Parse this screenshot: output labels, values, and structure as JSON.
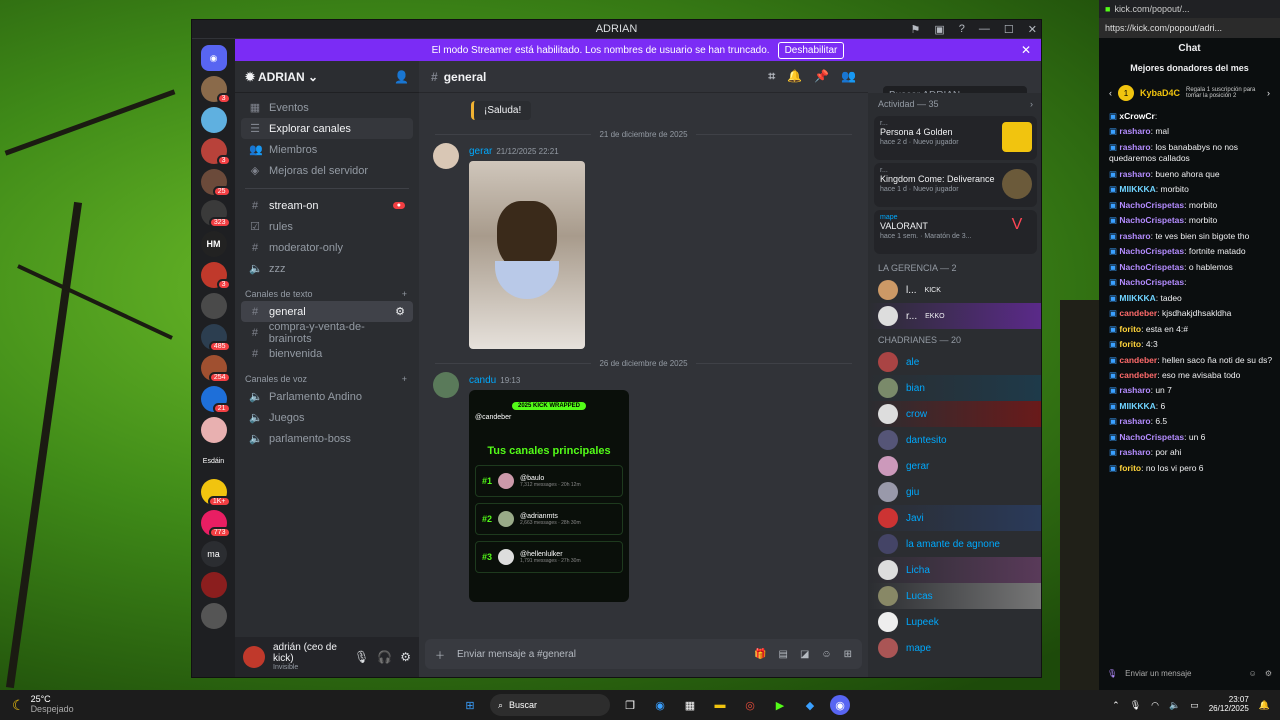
{
  "window": {
    "title": "ADRIAN"
  },
  "banner": {
    "text": "El modo Streamer está habilitado. Los nombres de usuario se han truncado.",
    "button": "Deshabilitar"
  },
  "server": {
    "name": "ADRIAN"
  },
  "nav": [
    "Eventos",
    "Explorar canales",
    "Miembros",
    "Mejoras del servidor"
  ],
  "channels_top": [
    {
      "name": "stream-on",
      "unread": true
    },
    {
      "name": "rules"
    },
    {
      "name": "moderator-only"
    },
    {
      "name": "zzz"
    }
  ],
  "text_category": "Canales de texto",
  "text_channels": [
    "general",
    "compra-y-venta-de-brainrots",
    "bienvenida"
  ],
  "voice_category": "Canales de voz",
  "voice_channels": [
    "Parlamento Andino",
    "Juegos",
    "parlamento-boss"
  ],
  "user": {
    "name": "adrián (ceo de kick)",
    "status": "Invisible"
  },
  "channel": {
    "name": "general",
    "search_placeholder": "Buscar ADRIAN"
  },
  "messages": {
    "pinned_text": "¡Saluda!",
    "date1": "21 de diciembre de 2025",
    "msg1_user": "gerar",
    "msg1_time": "21/12/2025 22:21",
    "date2": "26 de diciembre de 2025",
    "msg2_user": "candu",
    "msg2_time": "19:13",
    "wrapped": {
      "tag": "2025 KICK WRAPPED",
      "handle": "@candeber",
      "title": "Tus canales principales",
      "rows": [
        {
          "rank": "#1",
          "name": "@baulo",
          "stats": "7,312 messages · 20h 12m"
        },
        {
          "rank": "#2",
          "name": "@adrianmts",
          "stats": "2,663 messages · 28h 30m"
        },
        {
          "rank": "#3",
          "name": "@hellenlulker",
          "stats": "1,791 messages · 27h 30m"
        }
      ]
    }
  },
  "composer": {
    "placeholder": "Enviar mensaje a #general"
  },
  "members": {
    "activity_header": "Actividad — 35",
    "activities": [
      {
        "user": "r...",
        "game": "Persona 4 Golden",
        "sub": "hace 2 d · Nuevo jugador"
      },
      {
        "user": "r...",
        "game": "Kingdom Come: Deliverance",
        "sub": "hace 1 d · Nuevo jugador"
      },
      {
        "user": "mape",
        "game": "VALORANT",
        "sub": "hace 1 sem. · Maratón de 3..."
      }
    ],
    "group1": "LA GERENCIA — 2",
    "group1_items": [
      {
        "name": "l...",
        "tag": "KICK"
      },
      {
        "name": "r...",
        "tag": "EKKO"
      }
    ],
    "group2": "CHADRIANES — 20",
    "group2_items": [
      "ale",
      "bian",
      "crow",
      "dantesito",
      "gerar",
      "giu",
      "Javi",
      "la amante de agnone",
      "Licha",
      "Lucas",
      "Lupeek",
      "mape"
    ]
  },
  "kick": {
    "tab": "kick.com/popout/...",
    "url": "https://kick.com/popout/adri...",
    "title": "Chat",
    "top_donors": "Mejores donadores del mes",
    "donor": {
      "name": "KybaD4C",
      "rank": "1",
      "note": "Regala 1 suscripción para tomar la posición 2"
    },
    "chat": [
      {
        "user": "xCrowCr",
        "text": "",
        "color": "#ffffff"
      },
      {
        "user": "rasharo",
        "text": "mal",
        "color": "#b48cff"
      },
      {
        "user": "rasharo",
        "text": "los banababys no nos quedaremos callados",
        "color": "#b48cff"
      },
      {
        "user": "rasharo",
        "text": "bueno ahora que",
        "color": "#b48cff"
      },
      {
        "user": "MIIKKKA",
        "text": "morbito",
        "color": "#6fd3ff"
      },
      {
        "user": "NachoCrispetas",
        "text": "morbito",
        "color": "#b48cff"
      },
      {
        "user": "NachoCrispetas",
        "text": "morbito",
        "color": "#b48cff"
      },
      {
        "user": "rasharo",
        "text": "te ves bien sin bigote tho",
        "color": "#b48cff"
      },
      {
        "user": "NachoCrispetas",
        "text": "fortnite matado",
        "color": "#b48cff"
      },
      {
        "user": "NachoCrispetas",
        "text": "o hablemos",
        "color": "#b48cff"
      },
      {
        "user": "NachoCrispetas",
        "text": "",
        "color": "#b48cff"
      },
      {
        "user": "MIIKKKA",
        "text": "tadeo",
        "color": "#6fd3ff"
      },
      {
        "user": "candeber",
        "text": "kjsdhakjdhsakldha",
        "color": "#ff6b6b"
      },
      {
        "user": "forito",
        "text": "esta en 4:#",
        "color": "#ffd43b"
      },
      {
        "user": "forito",
        "text": "4:3",
        "color": "#ffd43b"
      },
      {
        "user": "candeber",
        "text": "hellen saco ña noti de su ds?",
        "color": "#ff6b6b"
      },
      {
        "user": "candeber",
        "text": "eso me avisaba todo",
        "color": "#ff6b6b"
      },
      {
        "user": "rasharo",
        "text": "un 7",
        "color": "#b48cff"
      },
      {
        "user": "MIIKKKA",
        "text": "6",
        "color": "#6fd3ff"
      },
      {
        "user": "rasharo",
        "text": "6.5",
        "color": "#b48cff"
      },
      {
        "user": "NachoCrispetas",
        "text": "un 6",
        "color": "#b48cff"
      },
      {
        "user": "rasharo",
        "text": "por ahi",
        "color": "#b48cff"
      },
      {
        "user": "forito",
        "text": "no los vi pero 6",
        "color": "#ffd43b"
      }
    ],
    "input_placeholder": "Enviar un mensaje"
  },
  "taskbar": {
    "temp": "25°C",
    "weather": "Despejado",
    "search": "Buscar",
    "time": "23:07",
    "date": "26/12/2025"
  }
}
